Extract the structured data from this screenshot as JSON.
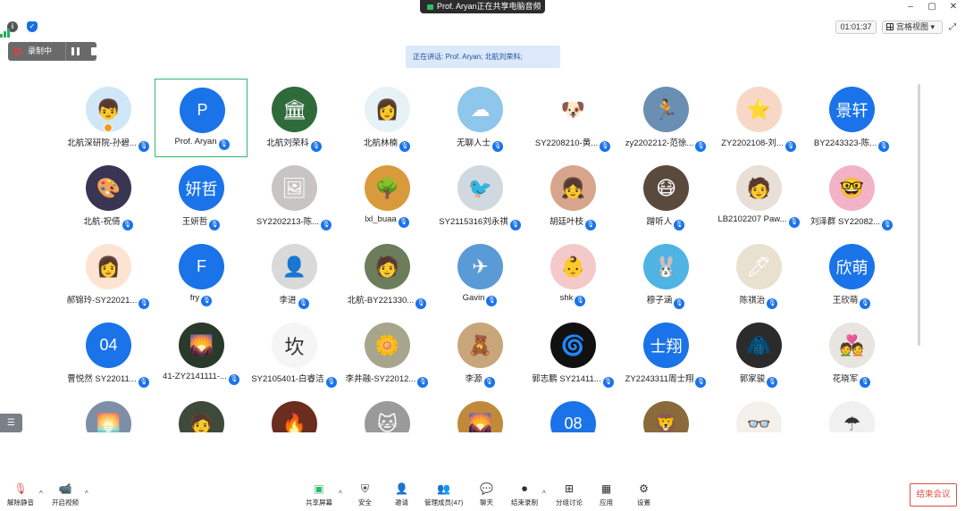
{
  "share_banner": "Prof. Aryan正在共享电脑音频",
  "window_controls": [
    "–",
    "▢",
    "✕"
  ],
  "timer": "01:01:37",
  "view_mode": "宫格视图",
  "recording": {
    "label": "录制中"
  },
  "speaking": "正在讲话: Prof. Aryan; 北航刘荣科;",
  "participants": [
    {
      "name": "北航深研院-孙碧...",
      "avatar": "pic",
      "glyph": "👦",
      "bg": "#cfe7f6",
      "host": true
    },
    {
      "name": "Prof. Aryan",
      "avatar": "text",
      "initials": "P",
      "active": true
    },
    {
      "name": "北航刘荣科",
      "avatar": "pic",
      "glyph": "🏛",
      "bg": "#2f6b3a"
    },
    {
      "name": "北航林楠",
      "avatar": "pic",
      "glyph": "👩",
      "bg": "#e7f2f7"
    },
    {
      "name": "无聊人士",
      "avatar": "pic",
      "glyph": "☁",
      "bg": "#8fc6ec"
    },
    {
      "name": "SY2208210-黄...",
      "avatar": "pic",
      "glyph": "🐶",
      "bg": "#ffffff"
    },
    {
      "name": "zy2202212-范徐...",
      "avatar": "pic",
      "glyph": "🏃",
      "bg": "#6a8fb3"
    },
    {
      "name": "ZY2202108-刘...",
      "avatar": "pic",
      "glyph": "⭐",
      "bg": "#f7d8c6"
    },
    {
      "name": "BY2243323-陈...",
      "avatar": "text",
      "initials": "景轩"
    },
    {
      "name": "北航-祝倩",
      "avatar": "pic",
      "glyph": "🎨",
      "bg": "#3a3552"
    },
    {
      "name": "王妍哲",
      "avatar": "text",
      "initials": "妍哲"
    },
    {
      "name": "SY2202213-陈...",
      "avatar": "pic",
      "glyph": "🖼",
      "bg": "#c7c4c3"
    },
    {
      "name": "lxl_buaa",
      "avatar": "pic",
      "glyph": "🌳",
      "bg": "#d89a3a"
    },
    {
      "name": "SY2115316刘永祺",
      "avatar": "pic",
      "glyph": "🐦",
      "bg": "#cfd9df"
    },
    {
      "name": "胡廷叶枝",
      "avatar": "pic",
      "glyph": "👧",
      "bg": "#d6a58b"
    },
    {
      "name": "蹭听人",
      "avatar": "pic",
      "glyph": "😷",
      "bg": "#5a4a3e"
    },
    {
      "name": "LB2102207 Paw...",
      "avatar": "pic",
      "glyph": "🧑",
      "bg": "#e8dfd6"
    },
    {
      "name": "刘泽群 SY22082...",
      "avatar": "pic",
      "glyph": "🤓",
      "bg": "#f2b3c6"
    },
    {
      "name": "郝锦玲-SY22021...",
      "avatar": "pic",
      "glyph": "👩",
      "bg": "#fde4d2"
    },
    {
      "name": "fry",
      "avatar": "text",
      "initials": "F"
    },
    {
      "name": "李进",
      "avatar": "pic",
      "glyph": "👤",
      "bg": "#d9d9d9"
    },
    {
      "name": "北航-BY221330...",
      "avatar": "pic",
      "glyph": "🧑",
      "bg": "#6b7d5a"
    },
    {
      "name": "Gavin",
      "avatar": "pic",
      "glyph": "✈",
      "bg": "#5a9ad6"
    },
    {
      "name": "shk",
      "avatar": "pic",
      "glyph": "👶",
      "bg": "#f4c9c9"
    },
    {
      "name": "穆子涵",
      "avatar": "pic",
      "glyph": "🐰",
      "bg": "#4fb3e3"
    },
    {
      "name": "陈祺治",
      "avatar": "pic",
      "glyph": "🖊",
      "bg": "#e9e1cf"
    },
    {
      "name": "王欣萌",
      "avatar": "text",
      "initials": "欣萌"
    },
    {
      "name": "曹悦然 SY22011...",
      "avatar": "text",
      "initials": "04"
    },
    {
      "name": "41-ZY2141111-...",
      "avatar": "pic",
      "glyph": "🌄",
      "bg": "#2a3a2a"
    },
    {
      "name": "SY2105401-白睿洁",
      "avatar": "pic",
      "glyph": "坎",
      "bg": "#f5f5f5",
      "dark": true
    },
    {
      "name": "李井融-SY22012...",
      "avatar": "pic",
      "glyph": "🌼",
      "bg": "#a7a58c"
    },
    {
      "name": "李源",
      "avatar": "pic",
      "glyph": "🧸",
      "bg": "#c9a57a"
    },
    {
      "name": "郭志鹏 SY21411...",
      "avatar": "pic",
      "glyph": "🌀",
      "bg": "#111111"
    },
    {
      "name": "ZY2243311周士翔",
      "avatar": "text",
      "initials": "士翔"
    },
    {
      "name": "郭家骏",
      "avatar": "pic",
      "glyph": "🧥",
      "bg": "#2b2b2b"
    },
    {
      "name": "花晓军",
      "avatar": "pic",
      "glyph": "💑",
      "bg": "#e8e4e0"
    },
    {
      "name": "",
      "avatar": "pic",
      "glyph": "🌅",
      "bg": "#7e8ea6"
    },
    {
      "name": "",
      "avatar": "pic",
      "glyph": "🧑",
      "bg": "#3e4a3a"
    },
    {
      "name": "",
      "avatar": "pic",
      "glyph": "🔥",
      "bg": "#6b2d1e"
    },
    {
      "name": "",
      "avatar": "pic",
      "glyph": "🐱",
      "bg": "#9a9a9a"
    },
    {
      "name": "",
      "avatar": "pic",
      "glyph": "🌄",
      "bg": "#c08a3a"
    },
    {
      "name": "",
      "avatar": "text",
      "initials": "08"
    },
    {
      "name": "",
      "avatar": "pic",
      "glyph": "🦁",
      "bg": "#8a6a3a"
    },
    {
      "name": "",
      "avatar": "pic",
      "glyph": "👓",
      "bg": "#f4f0ec",
      "dark": true
    },
    {
      "name": "",
      "avatar": "pic",
      "glyph": "☂",
      "bg": "#f0f0f0",
      "dark": true
    }
  ],
  "toolbar": {
    "unmute": "解除静音",
    "start_video": "开启视频",
    "share_screen": "共享屏幕",
    "security": "安全",
    "invite": "邀请",
    "participants": "管理成员(47)",
    "chat": "聊天",
    "end_recording": "结束录制",
    "breakout": "分组讨论",
    "apps": "应用",
    "settings": "设置",
    "end_meeting": "结束会议"
  },
  "colors": {
    "accent": "#1a73e8",
    "active_border": "#2eb86f",
    "end": "#e34b47"
  }
}
